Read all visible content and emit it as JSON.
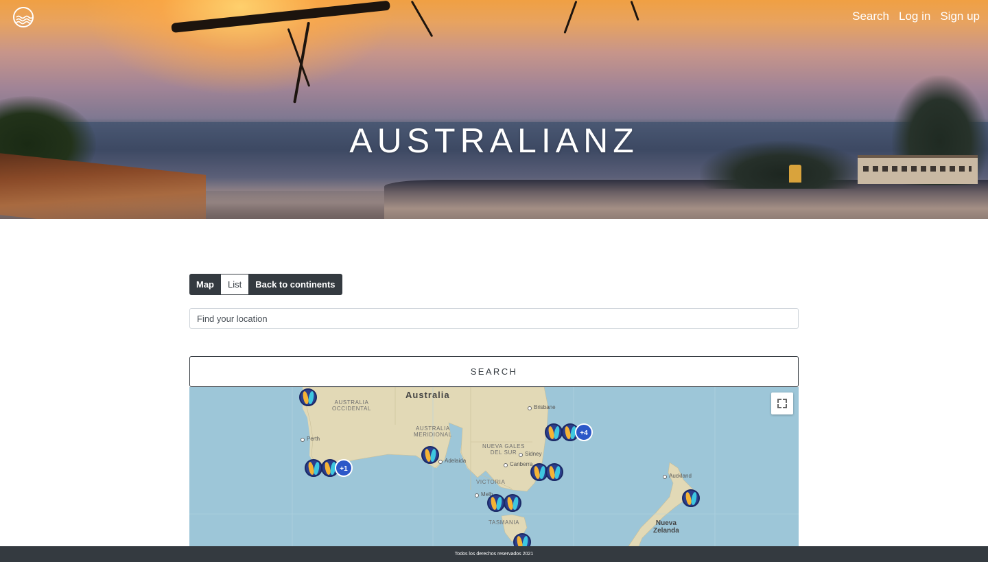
{
  "header": {
    "title": "AUSTRALIANZ",
    "nav": {
      "search": "Search",
      "login": "Log in",
      "signup": "Sign up"
    }
  },
  "view_toggle": {
    "map": "Map",
    "list": "List",
    "back": "Back to continents"
  },
  "search": {
    "placeholder": "Find your location",
    "button": "SEARCH"
  },
  "map": {
    "labels": {
      "australia": "Australia",
      "occidental": "AUSTRALIA\nOCCIDENTAL",
      "meridional": "AUSTRALIA\nMERIDIONAL",
      "nsw": "NUEVA GALES\nDEL SUR",
      "victoria": "VICTORIA",
      "tasmania": "TASMANIA",
      "nz": "Nueva\nZelanda"
    },
    "cities": {
      "perth": "Perth",
      "adelaida": "Adelaida",
      "melbourne": "Melb",
      "brisbane": "Brisbane",
      "sidney": "Sidney",
      "canberra": "Canberra",
      "auckland": "Auckland"
    },
    "clusters": {
      "east": "+4",
      "west": "+1"
    }
  },
  "footer": {
    "text": "Todos los derechos reservados 2021"
  }
}
